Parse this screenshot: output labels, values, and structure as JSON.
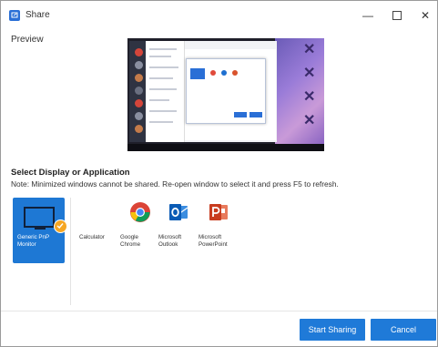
{
  "window": {
    "title": "Share",
    "minimize_glyph": "—",
    "close_glyph": "✕"
  },
  "preview": {
    "label": "Preview"
  },
  "sources": {
    "heading": "Select Display or Application",
    "note": "Note: Minimized windows cannot be shared. Re-open window to select it and press F5 to refresh.",
    "display": {
      "label": "Generic PnP Monitor",
      "selected": true,
      "icon": "monitor-icon"
    },
    "apps": [
      {
        "label": "Calculator",
        "icon": "none"
      },
      {
        "label": "Google Chrome",
        "icon": "chrome-icon"
      },
      {
        "label": "Microsoft Outlook",
        "icon": "outlook-icon"
      },
      {
        "label": "Microsoft PowerPoint",
        "icon": "powerpoint-icon"
      }
    ]
  },
  "footer": {
    "start_label": "Start Sharing",
    "cancel_label": "Cancel"
  },
  "colors": {
    "accent": "#1f7ad8",
    "selected_check": "#f5a623"
  }
}
